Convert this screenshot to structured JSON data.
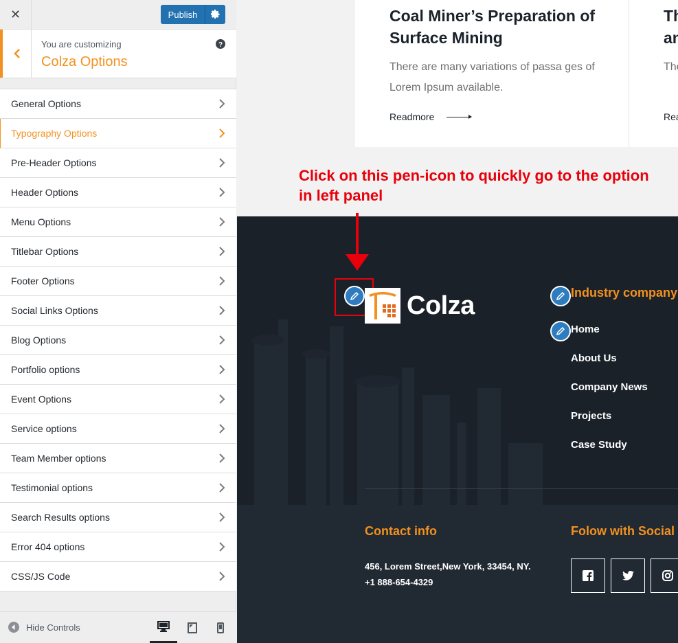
{
  "customizer": {
    "publish_label": "Publish",
    "close_icon": "close-icon",
    "info": {
      "customizing_label": "You are customizing",
      "title": "Colza Options"
    },
    "menu_items": [
      {
        "label": "General Options"
      },
      {
        "label": "Typography Options",
        "active": true
      },
      {
        "label": "Pre-Header Options"
      },
      {
        "label": "Header Options"
      },
      {
        "label": "Menu Options"
      },
      {
        "label": "Titlebar Options"
      },
      {
        "label": "Footer Options"
      },
      {
        "label": "Social Links Options"
      },
      {
        "label": "Blog Options"
      },
      {
        "label": "Portfolio options"
      },
      {
        "label": "Event Options"
      },
      {
        "label": "Service options"
      },
      {
        "label": "Team Member options"
      },
      {
        "label": "Testimonial options"
      },
      {
        "label": "Search Results options"
      },
      {
        "label": "Error 404 options"
      },
      {
        "label": "CSS/JS Code"
      }
    ],
    "footer": {
      "hide_controls_label": "Hide Controls"
    },
    "accent_color": "#f3911f",
    "publish_color": "#2271b1"
  },
  "preview": {
    "cards": [
      {
        "title": "Coal Miner’s Preparation of Surface Mining",
        "text": "There are many variations of passa ges of Lorem Ipsum available.",
        "link": "Readmore"
      },
      {
        "title": "Th an",
        "text": "The of",
        "link": "Rea"
      }
    ],
    "annotation": {
      "text": "Click on this pen-icon to quickly go to the option in left panel",
      "color": "#e8000b"
    },
    "footer": {
      "logo_text": "Colza",
      "menu_heading": "Industry company",
      "menu_links": [
        "Home",
        "About Us",
        "Company News",
        "Projects",
        "Case Study"
      ],
      "contact_heading": "Contact info",
      "contact_address": "456, Lorem Street,New York, 33454, NY.",
      "contact_phone": "+1 888-654-4329",
      "social_heading": "Folow with Social",
      "social_icons": [
        "facebook-icon",
        "twitter-icon",
        "instagram-icon"
      ]
    }
  }
}
